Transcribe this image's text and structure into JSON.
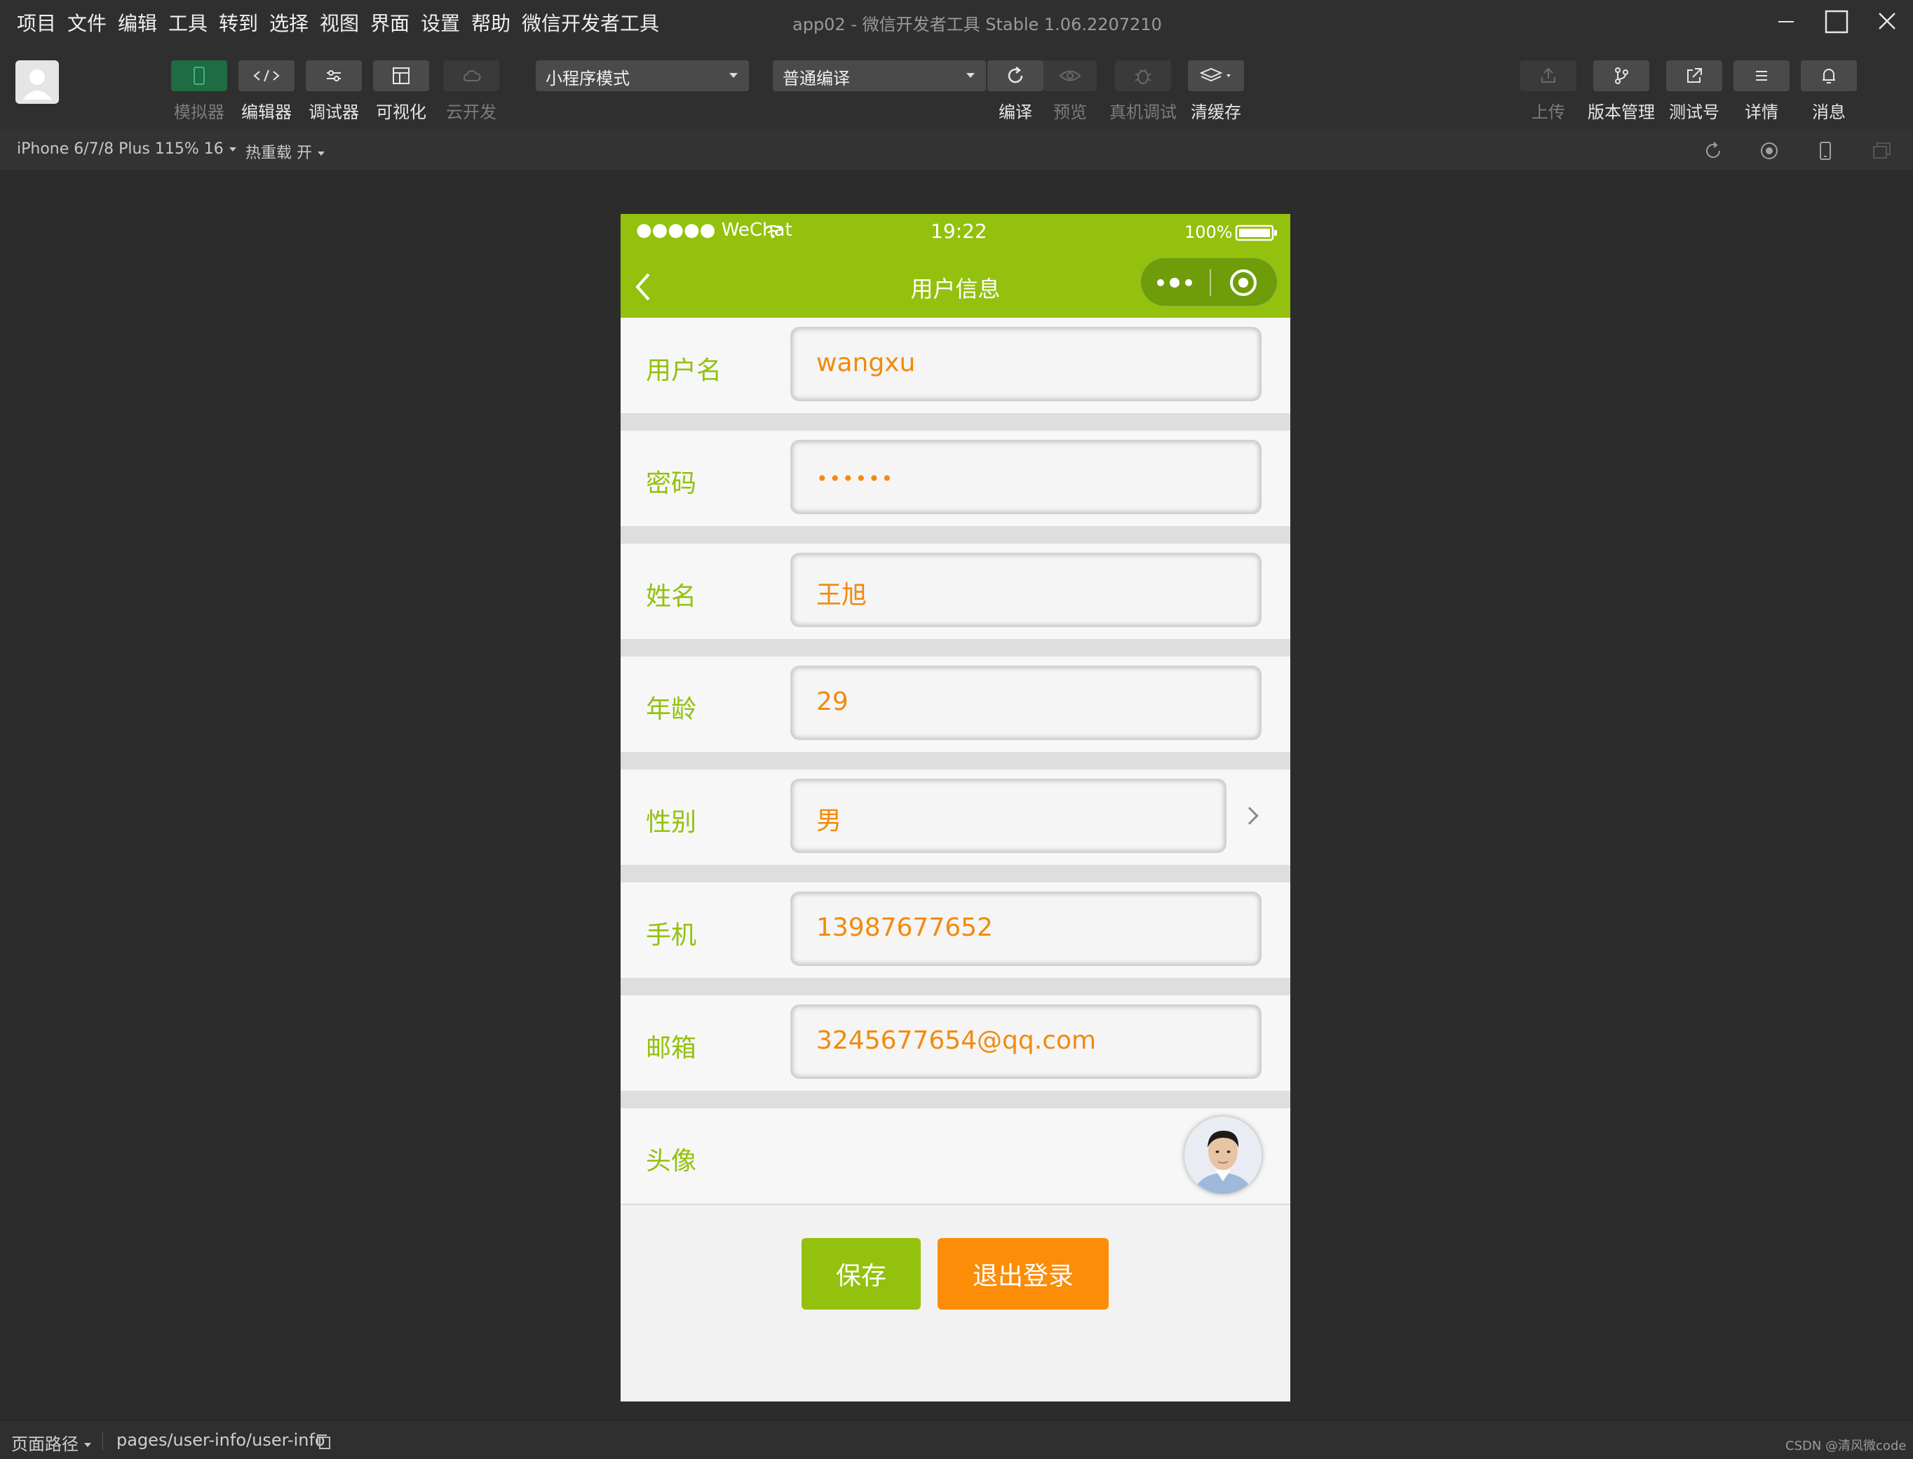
{
  "menubar": {
    "items": [
      "项目",
      "文件",
      "编辑",
      "工具",
      "转到",
      "选择",
      "视图",
      "界面",
      "设置",
      "帮助",
      "微信开发者工具"
    ],
    "window_title": "app02 - 微信开发者工具 Stable 1.06.2207210"
  },
  "toolbar": {
    "simulator": "模拟器",
    "editor": "编辑器",
    "debugger": "调试器",
    "visual": "可视化",
    "cloud": "云开发",
    "mode_select": "小程序模式",
    "compile_select": "普通编译",
    "compile": "编译",
    "preview": "预览",
    "remote_debug": "真机调试",
    "clear_cache": "清缓存",
    "upload": "上传",
    "version": "版本管理",
    "test_account": "测试号",
    "details": "详情",
    "messages": "消息"
  },
  "subbar": {
    "device": "iPhone 6/7/8 Plus 115% 16",
    "hot_reload": "热重载 开"
  },
  "phone": {
    "status": {
      "carrier": "●●●●● WeChat",
      "time": "19:22",
      "battery": "100%"
    },
    "nav_title": "用户信息",
    "fields": [
      {
        "label": "用户名",
        "value": "wangxu"
      },
      {
        "label": "密码",
        "value": "••••••"
      },
      {
        "label": "姓名",
        "value": "王旭"
      },
      {
        "label": "年龄",
        "value": "29"
      },
      {
        "label": "性别",
        "value": "男"
      },
      {
        "label": "手机",
        "value": "13987677652"
      },
      {
        "label": "邮箱",
        "value": "3245677654@qq.com"
      }
    ],
    "avatar_label": "头像",
    "save_button": "保存",
    "logout_button": "退出登录"
  },
  "statusbar": {
    "page_path_label": "页面路径",
    "page_path": "pages/user-info/user-info",
    "watermark": "CSDN @清风微code"
  },
  "colors": {
    "accent_green": "#93c10d",
    "value_orange": "#f28a0c",
    "logout_orange": "#fb8d09",
    "active_tool": "#1f6b42"
  }
}
